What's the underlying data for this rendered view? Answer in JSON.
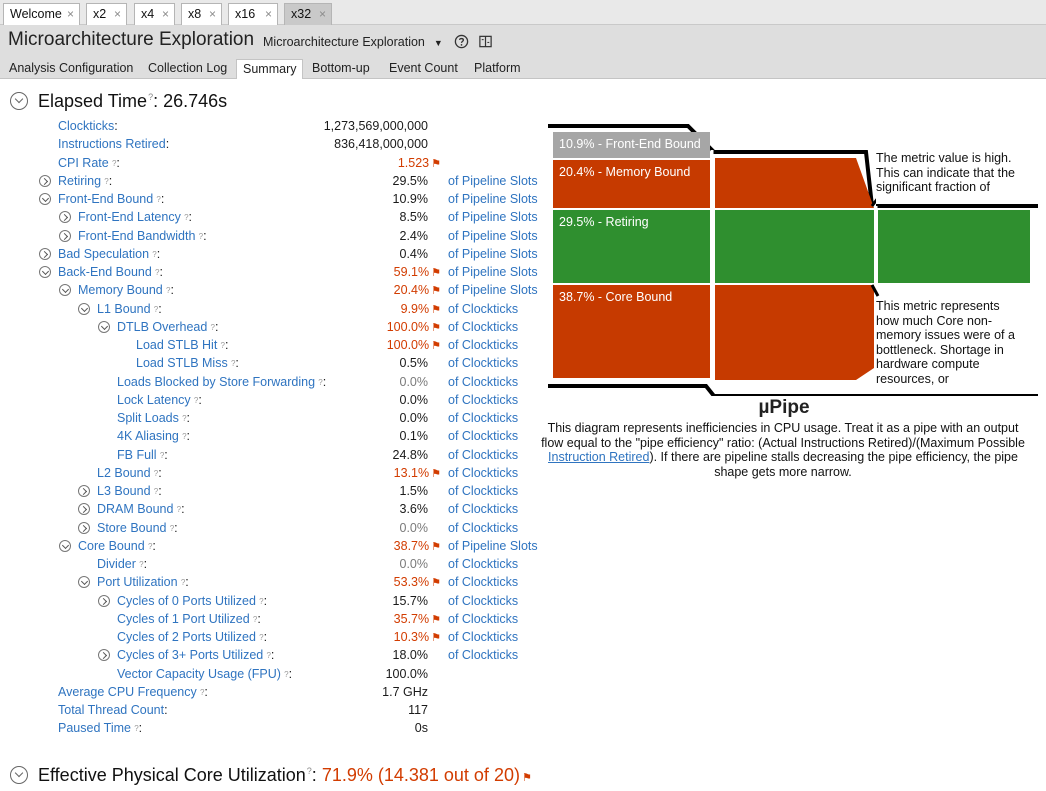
{
  "tabs": [
    {
      "label": "Welcome",
      "active": false
    },
    {
      "label": "x2",
      "active": false
    },
    {
      "label": "x4",
      "active": false
    },
    {
      "label": "x8",
      "active": false
    },
    {
      "label": "x16",
      "active": false
    },
    {
      "label": "x32",
      "active": true
    }
  ],
  "tab_close_glyph": "×",
  "header": {
    "title": "Microarchitecture Exploration",
    "view_select": "Microarchitecture Exploration",
    "icons": [
      "help-icon",
      "compare-icon"
    ]
  },
  "subtabs": [
    {
      "label": "Analysis Configuration",
      "active": false
    },
    {
      "label": "Collection Log",
      "active": false
    },
    {
      "label": "Summary",
      "active": true
    },
    {
      "label": "Bottom-up",
      "active": false
    },
    {
      "label": "Event Count",
      "active": false
    },
    {
      "label": "Platform",
      "active": false
    }
  ],
  "elapsed": {
    "label": "Elapsed Time",
    "value": "26.746s"
  },
  "metrics": [
    {
      "name": "Clockticks",
      "value": "1,273,569,000,000",
      "unit": "",
      "level": 0,
      "expander": "none",
      "flag": false,
      "help": false
    },
    {
      "name": "Instructions Retired",
      "value": "836,418,000,000",
      "unit": "",
      "level": 0,
      "expander": "none",
      "flag": false,
      "help": false
    },
    {
      "name": "CPI Rate",
      "value": "1.523",
      "unit": "",
      "level": 0,
      "expander": "none",
      "flag": true,
      "help": true
    },
    {
      "name": "Retiring",
      "value": "29.5%",
      "unit": "of Pipeline Slots",
      "level": 0,
      "expander": "right",
      "flag": false,
      "help": true
    },
    {
      "name": "Front-End Bound",
      "value": "10.9%",
      "unit": "of Pipeline Slots",
      "level": 0,
      "expander": "down",
      "flag": false,
      "help": true
    },
    {
      "name": "Front-End Latency",
      "value": "8.5%",
      "unit": "of Pipeline Slots",
      "level": 1,
      "expander": "right",
      "flag": false,
      "help": true
    },
    {
      "name": "Front-End Bandwidth",
      "value": "2.4%",
      "unit": "of Pipeline Slots",
      "level": 1,
      "expander": "right",
      "flag": false,
      "help": true
    },
    {
      "name": "Bad Speculation",
      "value": "0.4%",
      "unit": "of Pipeline Slots",
      "level": 0,
      "expander": "right",
      "flag": false,
      "help": true
    },
    {
      "name": "Back-End Bound",
      "value": "59.1%",
      "unit": "of Pipeline Slots",
      "level": 0,
      "expander": "down",
      "flag": true,
      "help": true
    },
    {
      "name": "Memory Bound",
      "value": "20.4%",
      "unit": "of Pipeline Slots",
      "level": 1,
      "expander": "down",
      "flag": true,
      "help": true
    },
    {
      "name": "L1 Bound",
      "value": "9.9%",
      "unit": "of Clockticks",
      "level": 2,
      "expander": "down",
      "flag": true,
      "help": true
    },
    {
      "name": "DTLB Overhead",
      "value": "100.0%",
      "unit": "of Clockticks",
      "level": 3,
      "expander": "down",
      "flag": true,
      "help": true
    },
    {
      "name": "Load STLB Hit",
      "value": "100.0%",
      "unit": "of Clockticks",
      "level": 4,
      "expander": "none",
      "flag": true,
      "help": true
    },
    {
      "name": "Load STLB Miss",
      "value": "0.5%",
      "unit": "of Clockticks",
      "level": 4,
      "expander": "none",
      "flag": false,
      "help": true
    },
    {
      "name": "Loads Blocked by Store Forwarding",
      "value": "0.0%",
      "unit": "of Clockticks",
      "level": 3,
      "expander": "none",
      "flag": false,
      "help": true,
      "gray": true
    },
    {
      "name": "Lock Latency",
      "value": "0.0%",
      "unit": "of Clockticks",
      "level": 3,
      "expander": "none",
      "flag": false,
      "help": true
    },
    {
      "name": "Split Loads",
      "value": "0.0%",
      "unit": "of Clockticks",
      "level": 3,
      "expander": "none",
      "flag": false,
      "help": true
    },
    {
      "name": "4K Aliasing",
      "value": "0.1%",
      "unit": "of Clockticks",
      "level": 3,
      "expander": "none",
      "flag": false,
      "help": true
    },
    {
      "name": "FB Full",
      "value": "24.8%",
      "unit": "of Clockticks",
      "level": 3,
      "expander": "none",
      "flag": false,
      "help": true
    },
    {
      "name": "L2 Bound",
      "value": "13.1%",
      "unit": "of Clockticks",
      "level": 2,
      "expander": "none",
      "flag": true,
      "help": true
    },
    {
      "name": "L3 Bound",
      "value": "1.5%",
      "unit": "of Clockticks",
      "level": 2,
      "expander": "right",
      "flag": false,
      "help": true
    },
    {
      "name": "DRAM Bound",
      "value": "3.6%",
      "unit": "of Clockticks",
      "level": 2,
      "expander": "right",
      "flag": false,
      "help": true
    },
    {
      "name": "Store Bound",
      "value": "0.0%",
      "unit": "of Clockticks",
      "level": 2,
      "expander": "right",
      "flag": false,
      "help": true,
      "gray": true
    },
    {
      "name": "Core Bound",
      "value": "38.7%",
      "unit": "of Pipeline Slots",
      "level": 1,
      "expander": "down",
      "flag": true,
      "help": true
    },
    {
      "name": "Divider",
      "value": "0.0%",
      "unit": "of Clockticks",
      "level": 2,
      "expander": "none",
      "flag": false,
      "help": true,
      "gray": true
    },
    {
      "name": "Port Utilization",
      "value": "53.3%",
      "unit": "of Clockticks",
      "level": 2,
      "expander": "down",
      "flag": true,
      "help": true
    },
    {
      "name": "Cycles of 0 Ports Utilized",
      "value": "15.7%",
      "unit": "of Clockticks",
      "level": 3,
      "expander": "right",
      "flag": false,
      "help": true
    },
    {
      "name": "Cycles of 1 Port Utilized",
      "value": "35.7%",
      "unit": "of Clockticks",
      "level": 3,
      "expander": "none",
      "flag": true,
      "help": true
    },
    {
      "name": "Cycles of 2 Ports Utilized",
      "value": "10.3%",
      "unit": "of Clockticks",
      "level": 3,
      "expander": "none",
      "flag": true,
      "help": true
    },
    {
      "name": "Cycles of 3+ Ports Utilized",
      "value": "18.0%",
      "unit": "of Clockticks",
      "level": 3,
      "expander": "right",
      "flag": false,
      "help": true
    },
    {
      "name": "Vector Capacity Usage (FPU)",
      "value": "100.0%",
      "unit": "",
      "level": 3,
      "expander": "none",
      "flag": false,
      "help": true
    },
    {
      "name": "Average CPU Frequency",
      "value": "1.7 GHz",
      "unit": "",
      "level": 0,
      "expander": "none",
      "flag": false,
      "help": true
    },
    {
      "name": "Total Thread Count",
      "value": "117",
      "unit": "",
      "level": 0,
      "expander": "none",
      "flag": false,
      "help": false
    },
    {
      "name": "Paused Time",
      "value": "0s",
      "unit": "",
      "level": 0,
      "expander": "none",
      "flag": false,
      "help": true
    }
  ],
  "pipe": {
    "segments": [
      {
        "label": "10.9% - Front-End Bound",
        "value": 10.9,
        "color": "#a6a6a6"
      },
      {
        "label": "20.4% - Memory Bound",
        "value": 20.4,
        "color": "#c63a00"
      },
      {
        "label": "29.5% - Retiring",
        "value": 29.5,
        "color": "#2f8f2f"
      },
      {
        "label": "38.7% - Core Bound",
        "value": 38.7,
        "color": "#c63a00"
      }
    ],
    "title": "µPipe",
    "description_prefix": "This diagram represents inefficiencies in CPU usage. Treat it as a pipe with an output flow equal to the \"pipe efficiency\" ratio: (Actual Instructions Retired)/(Maximum Possible ",
    "description_link": "Instruction Retired",
    "description_suffix": "). If there are pipeline stalls decreasing the pipe efficiency, the pipe shape gets more narrow.",
    "tooltip_top": "The metric value is high. This can indicate that the significant fraction of",
    "tooltip_bottom": "This metric represents how much Core non-memory issues were of a bottleneck. Shortage in hardware compute resources, or"
  },
  "effective": {
    "label": "Effective Physical Core Utilization",
    "value": "71.9% (14.381 out of 20)"
  }
}
